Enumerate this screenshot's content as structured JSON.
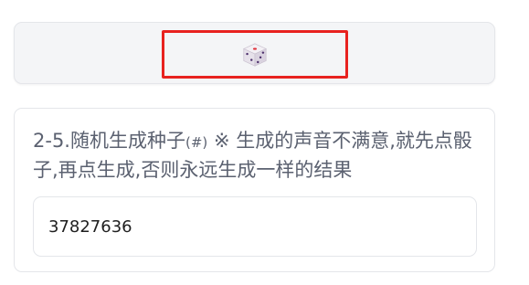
{
  "dice": {
    "icon": "dice-icon"
  },
  "seed": {
    "label_prefix": "2-5.随机生成种子",
    "label_hash": "(#)",
    "label_suffix": " ※ 生成的声音不满意,就先点骰子,再点生成,否则永远生成一样的结果",
    "value": "37827636"
  }
}
